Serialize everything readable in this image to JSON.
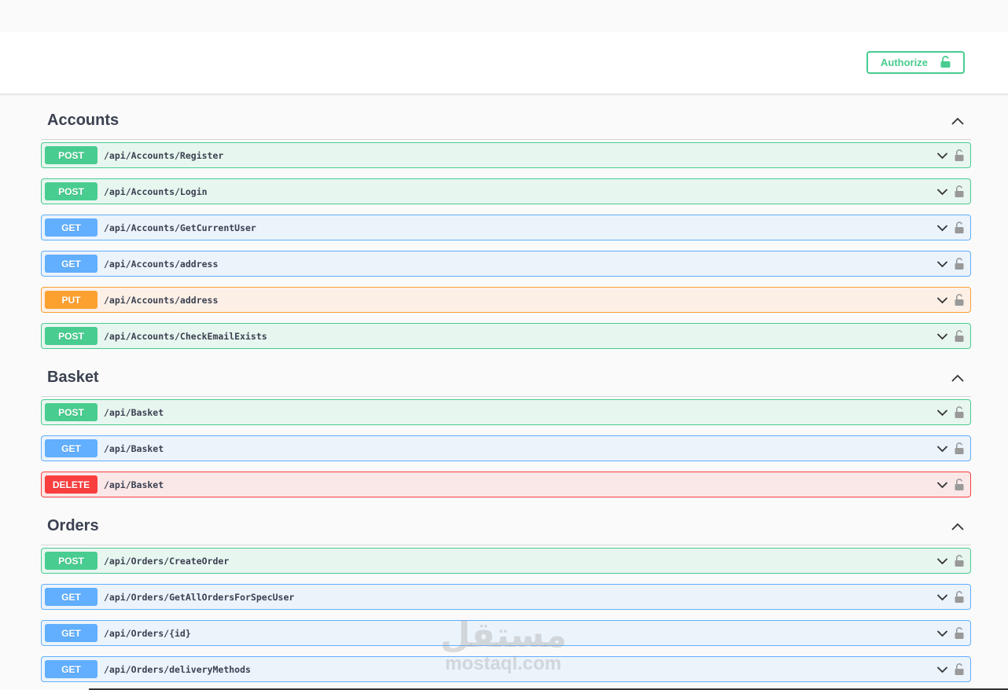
{
  "header": {
    "authorize_label": "Authorize",
    "authorize_icon": "lock-icon",
    "accent_color": "#49cc90"
  },
  "method_colors": {
    "POST": "#49cc90",
    "GET": "#61affe",
    "PUT": "#fca130",
    "DELETE": "#f93e3e"
  },
  "tags": [
    {
      "name": "Accounts",
      "operations": [
        {
          "method": "POST",
          "path": "/api/Accounts/Register"
        },
        {
          "method": "POST",
          "path": "/api/Accounts/Login"
        },
        {
          "method": "GET",
          "path": "/api/Accounts/GetCurrentUser"
        },
        {
          "method": "GET",
          "path": "/api/Accounts/address"
        },
        {
          "method": "PUT",
          "path": "/api/Accounts/address"
        },
        {
          "method": "POST",
          "path": "/api/Accounts/CheckEmailExists"
        }
      ]
    },
    {
      "name": "Basket",
      "operations": [
        {
          "method": "POST",
          "path": "/api/Basket"
        },
        {
          "method": "GET",
          "path": "/api/Basket"
        },
        {
          "method": "DELETE",
          "path": "/api/Basket"
        }
      ]
    },
    {
      "name": "Orders",
      "operations": [
        {
          "method": "POST",
          "path": "/api/Orders/CreateOrder"
        },
        {
          "method": "GET",
          "path": "/api/Orders/GetAllOrdersForSpecUser"
        },
        {
          "method": "GET",
          "path": "/api/Orders/{id}"
        },
        {
          "method": "GET",
          "path": "/api/Orders/deliveryMethods"
        }
      ]
    }
  ],
  "watermark": {
    "arabic": "مستقل",
    "latin": "mostaql.com"
  }
}
